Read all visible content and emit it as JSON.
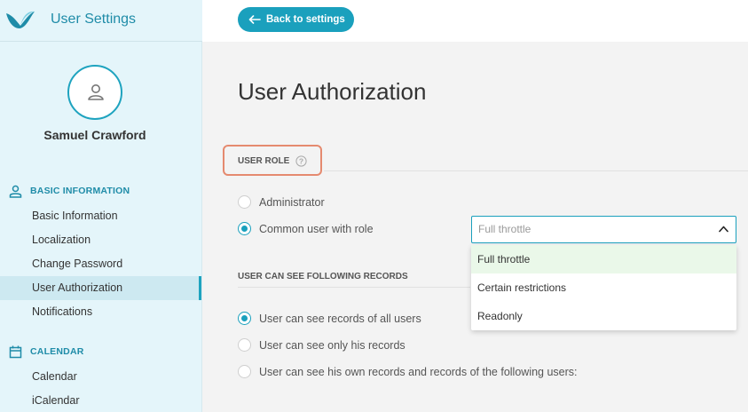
{
  "app": {
    "title": "User Settings"
  },
  "user": {
    "name": "Samuel Crawford"
  },
  "sidebar": {
    "sections": [
      {
        "title": "BASIC INFORMATION",
        "icon": "person-icon",
        "items": [
          "Basic Information",
          "Localization",
          "Change Password",
          "User Authorization",
          "Notifications"
        ]
      },
      {
        "title": "CALENDAR",
        "icon": "calendar-icon",
        "items": [
          "Calendar",
          "iCalendar"
        ]
      }
    ],
    "active_item": "User Authorization"
  },
  "topbar": {
    "back_label": "Back to settings"
  },
  "main": {
    "title": "User Authorization",
    "user_role": {
      "label": "USER ROLE",
      "options": [
        "Administrator",
        "Common user with role"
      ],
      "selected": "Common user with role",
      "select": {
        "value": "Full throttle",
        "options": [
          "Full throttle",
          "Certain restrictions",
          "Readonly"
        ],
        "highlighted": "Full throttle"
      }
    },
    "records": {
      "label": "USER CAN SEE FOLLOWING RECORDS",
      "options": [
        "User can see records of all users",
        "User can see only his records",
        "User can see his own records and records of the following users:"
      ],
      "selected": "User can see records of all users"
    }
  },
  "colors": {
    "accent": "#1aa0bd",
    "highlight_border": "#e58a6f",
    "sidebar_bg": "#e4f5fa"
  }
}
